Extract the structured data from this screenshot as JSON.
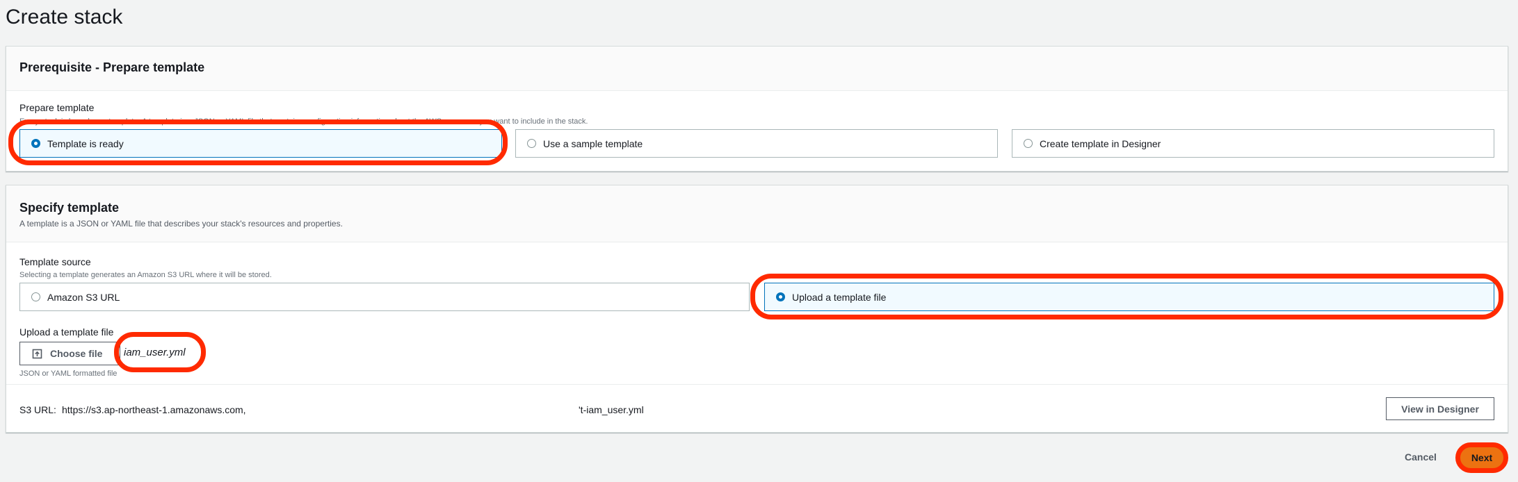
{
  "page": {
    "title": "Create stack"
  },
  "prerequisite": {
    "title": "Prerequisite - Prepare template",
    "field_label": "Prepare template",
    "field_desc": "Every stack is based on a template. A template is a JSON or YAML file that contains configuration information about the AWS resources you want to include in the stack.",
    "options": [
      {
        "label": "Template is ready",
        "selected": true
      },
      {
        "label": "Use a sample template",
        "selected": false
      },
      {
        "label": "Create template in Designer",
        "selected": false
      }
    ]
  },
  "specify": {
    "title": "Specify template",
    "desc": "A template is a JSON or YAML file that describes your stack's resources and properties.",
    "source_label": "Template source",
    "source_desc": "Selecting a template generates an Amazon S3 URL where it will be stored.",
    "sources": [
      {
        "label": "Amazon S3 URL",
        "selected": false
      },
      {
        "label": "Upload a template file",
        "selected": true
      }
    ],
    "upload_label": "Upload a template file",
    "choose_file": "Choose file",
    "file_name": "iam_user.yml",
    "file_hint": "JSON or YAML formatted file",
    "s3_label": "S3 URL:",
    "s3_url_start": "https://s3.ap-northeast-1.amazonaws.com,",
    "s3_url_end": "'t-iam_user.yml",
    "view_designer": "View in Designer"
  },
  "footer": {
    "cancel": "Cancel",
    "next": "Next"
  },
  "colors": {
    "accent": "#0073bb",
    "primary": "#ec7211",
    "annotation": "#ff2a00"
  },
  "icons": {
    "upload": "upload-icon"
  }
}
